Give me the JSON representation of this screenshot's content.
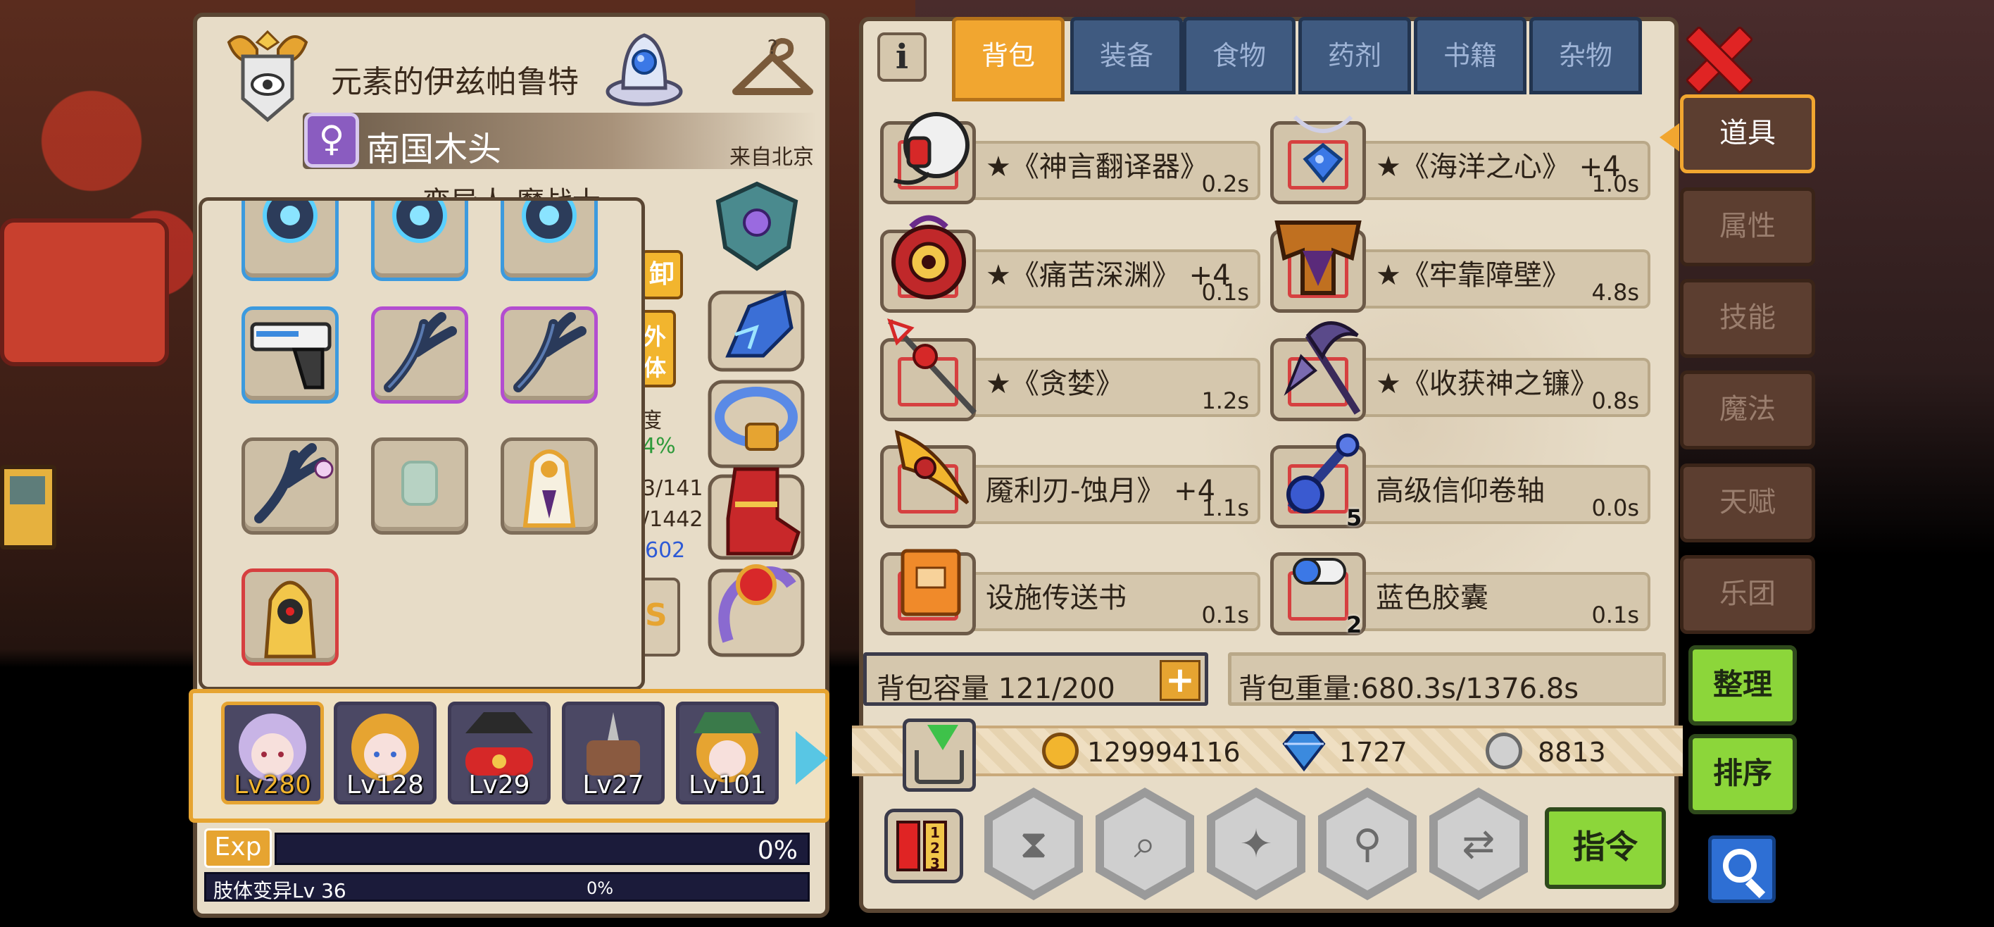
{
  "character": {
    "class_title": "元素的伊兹帕鲁特",
    "name": "南国木头",
    "origin": "来自北京",
    "race_partial": "变异人 魔战士",
    "unequip_label": "卸",
    "outer_label": "外\n体",
    "stat_label": "度",
    "stat_pct": "4%",
    "stat_value1": "3/141",
    "stat_value2": "/1442",
    "stat_value3": "602"
  },
  "equipment": {
    "slots": [
      {
        "icon": "blue-orb-ring-icon"
      },
      {
        "icon": "blue-orb-ring-icon"
      },
      {
        "icon": "blue-orb-ring-icon"
      },
      {
        "icon": "laser-pistol-icon"
      },
      {
        "icon": "dark-branch-icon"
      },
      {
        "icon": "dark-branch-icon"
      },
      {
        "icon": "dark-branch-skull-icon"
      },
      {
        "icon": "empty-slot-icon"
      },
      {
        "icon": "golden-robe-icon"
      },
      {
        "icon": "yellow-hood-icon"
      }
    ]
  },
  "party": {
    "members": [
      {
        "level": "Lv280",
        "active": true
      },
      {
        "level": "Lv128",
        "active": false
      },
      {
        "level": "Lv29",
        "active": false
      },
      {
        "level": "Lv27",
        "active": false
      },
      {
        "level": "Lv101",
        "active": false
      }
    ]
  },
  "exp": {
    "badge": "Exp",
    "percent": "0%",
    "exp_fill": 0,
    "limb_label": "肢体变异Lv 36",
    "limb_percent": "0%",
    "limb_fill": 0
  },
  "inventory": {
    "info_label": "i",
    "tabs": [
      {
        "label": "背包",
        "active": true
      },
      {
        "label": "装备",
        "active": false
      },
      {
        "label": "食物",
        "active": false
      },
      {
        "label": "药剂",
        "active": false
      },
      {
        "label": "书籍",
        "active": false
      },
      {
        "label": "杂物",
        "active": false
      }
    ],
    "items": [
      {
        "name": "★《神言翻译器》",
        "weight": "0.2s",
        "qty": "",
        "icon": "headset-icon"
      },
      {
        "name": "★《海洋之心》 +4",
        "weight": "1.0s",
        "qty": "",
        "icon": "ocean-heart-necklace-icon"
      },
      {
        "name": "★《痛苦深渊》 +4",
        "weight": "0.1s",
        "qty": "",
        "icon": "abyss-eye-icon"
      },
      {
        "name": "★《牢靠障壁》",
        "weight": "4.8s",
        "qty": "",
        "icon": "armor-barrier-icon"
      },
      {
        "name": "★《贪婪》",
        "weight": "1.2s",
        "qty": "",
        "icon": "greed-spear-icon"
      },
      {
        "name": "★《收获神之镰》",
        "weight": "0.8s",
        "qty": "",
        "icon": "scythe-icon"
      },
      {
        "name": "魇利刃-蚀月》 +4",
        "weight": "1.1s",
        "qty": "",
        "icon": "moon-blade-icon"
      },
      {
        "name": "高级信仰卷轴",
        "weight": "0.0s",
        "qty": "5",
        "icon": "faith-scroll-icon"
      },
      {
        "name": "设施传送书",
        "weight": "0.1s",
        "qty": "",
        "icon": "teleport-book-icon"
      },
      {
        "name": "蓝色胶囊",
        "weight": "0.1s",
        "qty": "2",
        "icon": "blue-capsule-icon"
      }
    ],
    "capacity": "背包容量 121/200",
    "weight_total": "背包重量:680.3s/1376.8s"
  },
  "currency": {
    "gold": "129994116",
    "diamond": "1727",
    "silver": "8813"
  },
  "actions": {
    "command_label": "指令"
  },
  "side_tabs": [
    {
      "label": "道具",
      "active": true
    },
    {
      "label": "属性",
      "active": false
    },
    {
      "label": "技能",
      "active": false
    },
    {
      "label": "魔法",
      "active": false
    },
    {
      "label": "天赋",
      "active": false
    },
    {
      "label": "乐团",
      "active": false
    }
  ],
  "side_buttons": {
    "sort_label": "整理",
    "order_label": "排序"
  },
  "colors": {
    "accent_orange": "#f1a630",
    "tab_blue": "#3f5a80",
    "panel_bg": "#e7dcc7",
    "button_green": "#8cd63a",
    "close_red": "#e02424"
  }
}
